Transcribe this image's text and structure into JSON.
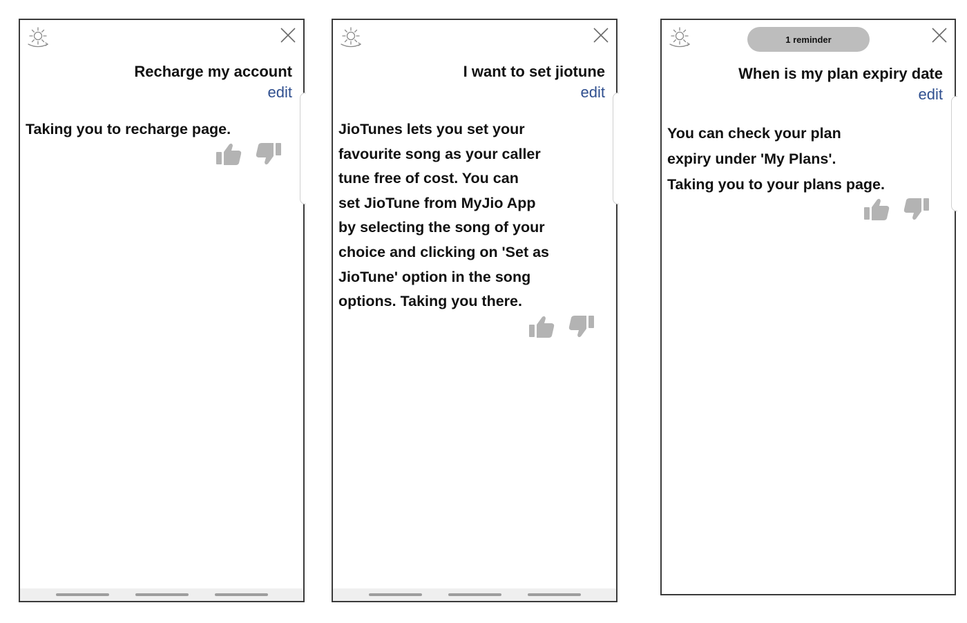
{
  "colors": {
    "edit_link": "#2f4f8f",
    "thumbs": "#b3b3b3",
    "reminder_bg": "#bdbdbd",
    "border": "#3a3a3a"
  },
  "panels": [
    {
      "query": "Recharge my account",
      "edit_label": "edit",
      "response_lines": [
        "Taking you to recharge page."
      ],
      "icons": [
        "assistant-sun-icon",
        "close-icon",
        "thumbs-up-icon",
        "thumbs-down-icon"
      ]
    },
    {
      "query": "I want to set jiotune",
      "edit_label": "edit",
      "response_lines": [
        "JioTunes lets you set your",
        "favourite song as your caller",
        "tune free of cost. You can",
        "set JioTune from MyJio App",
        "by selecting the song of your",
        "choice and clicking on 'Set as",
        "JioTune' option in the song",
        "options. Taking you there."
      ],
      "icons": [
        "assistant-sun-icon",
        "close-icon",
        "thumbs-up-icon",
        "thumbs-down-icon"
      ]
    },
    {
      "reminder": "1 reminder",
      "query": "When is my plan expiry date",
      "edit_label": "edit",
      "response_lines": [
        "You can check your plan",
        "expiry under 'My Plans'.",
        "Taking you to your plans page."
      ],
      "icons": [
        "assistant-sun-icon",
        "close-icon",
        "thumbs-up-icon",
        "thumbs-down-icon"
      ]
    }
  ]
}
